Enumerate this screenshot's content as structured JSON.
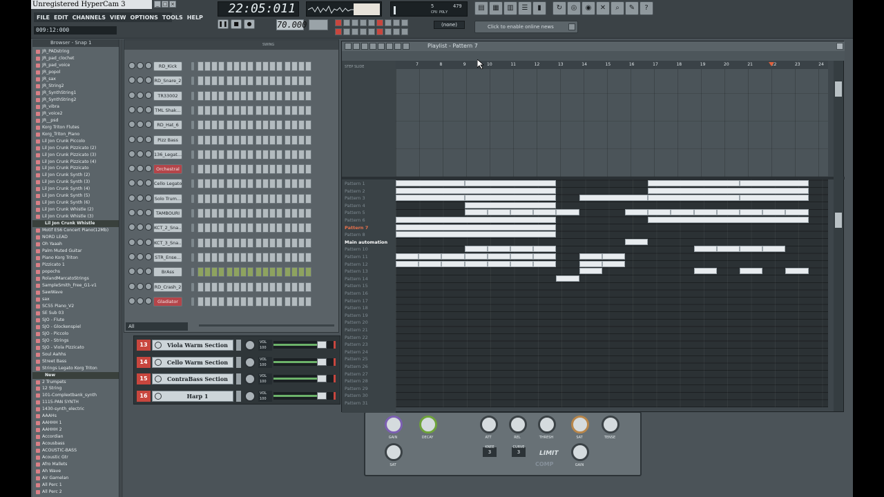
{
  "app": {
    "title": "Unregistered HyperCam 3",
    "menu": [
      "FILE",
      "EDIT",
      "CHANNELS",
      "VIEW",
      "OPTIONS",
      "TOOLS",
      "HELP"
    ],
    "song_time_small": "009:12:000",
    "clock": "22:05:011",
    "tempo": "70.000",
    "snap": "(none)",
    "news": "Click to enable online news",
    "cpu_a": "5",
    "cpu_b": "479",
    "cpu_c": "CPU POLY"
  },
  "browser": {
    "title": "Browser - Snap 1",
    "items": [
      {
        "label": "JR_PADstring",
        "type": "file"
      },
      {
        "label": "JR_pad_clochet",
        "type": "file"
      },
      {
        "label": "JR_pad_voice",
        "type": "file"
      },
      {
        "label": "JR_popol",
        "type": "file"
      },
      {
        "label": "JR_sax",
        "type": "file"
      },
      {
        "label": "JR_String2",
        "type": "file"
      },
      {
        "label": "JR_SynthString1",
        "type": "file"
      },
      {
        "label": "JR_SynthString2",
        "type": "file"
      },
      {
        "label": "JR_vibra",
        "type": "file"
      },
      {
        "label": "JR_voice2",
        "type": "file"
      },
      {
        "label": "JR__psd",
        "type": "file"
      },
      {
        "label": "Korg Triton Flutes",
        "type": "file"
      },
      {
        "label": "Korg_Triton_Piano",
        "type": "file"
      },
      {
        "label": "Lil Jon Crunk Piccolo",
        "type": "file"
      },
      {
        "label": "Lil Jon Crunk Pizzicato (2)",
        "type": "file"
      },
      {
        "label": "Lil Jon Crunk Pizzicato (3)",
        "type": "file"
      },
      {
        "label": "Lil Jon Crunk Pizzicato (4)",
        "type": "file"
      },
      {
        "label": "Lil Jon Crunk Pizzicato",
        "type": "file"
      },
      {
        "label": "Lil Jon Crunk Synth (2)",
        "type": "file"
      },
      {
        "label": "Lil Jon Crunk Synth (3)",
        "type": "file"
      },
      {
        "label": "Lil Jon Crunk Synth (4)",
        "type": "file"
      },
      {
        "label": "Lil Jon Crunk Synth (5)",
        "type": "file"
      },
      {
        "label": "Lil Jon Crunk Synth (6)",
        "type": "file"
      },
      {
        "label": "Lil Jon Crunk Whistle (2)",
        "type": "file"
      },
      {
        "label": "Lil Jon Crunk Whistle (3)",
        "type": "file"
      },
      {
        "label": "Lil Jon Crunk Whistle",
        "type": "folder"
      },
      {
        "label": "Motif ES6 Concert Piano(12Mb)",
        "type": "file"
      },
      {
        "label": "NORD LEAD",
        "type": "file"
      },
      {
        "label": "Oh Yaaah",
        "type": "file"
      },
      {
        "label": "Palm Muted Guitar",
        "type": "file"
      },
      {
        "label": "Piano Korg Triton",
        "type": "file"
      },
      {
        "label": "Pizzicato 1",
        "type": "file"
      },
      {
        "label": "popochs",
        "type": "file"
      },
      {
        "label": "RolandMarcatoStrings",
        "type": "file"
      },
      {
        "label": "SampleSmith_Free_G1-v1",
        "type": "file"
      },
      {
        "label": "SawWave",
        "type": "file"
      },
      {
        "label": "sax",
        "type": "file"
      },
      {
        "label": "SC55 Piano_V2",
        "type": "file"
      },
      {
        "label": "SE Sub 03",
        "type": "file"
      },
      {
        "label": "SJO - Flute",
        "type": "file"
      },
      {
        "label": "SJO - Glockenspiel",
        "type": "file"
      },
      {
        "label": "SJO - Piccolo",
        "type": "file"
      },
      {
        "label": "SJO - Strings",
        "type": "file"
      },
      {
        "label": "SJO - Viola Pizzicato",
        "type": "file"
      },
      {
        "label": "Soul Aahhs",
        "type": "file"
      },
      {
        "label": "Street Bass",
        "type": "file"
      },
      {
        "label": "Strings Legato Korg Triton",
        "type": "file"
      },
      {
        "label": "New",
        "type": "folder"
      },
      {
        "label": "2 Trumpets",
        "type": "file"
      },
      {
        "label": "12 String",
        "type": "file"
      },
      {
        "label": "101-Complextbank_synth",
        "type": "file"
      },
      {
        "label": "1115-PAN SYNTH",
        "type": "file"
      },
      {
        "label": "1430-synth_electric",
        "type": "file"
      },
      {
        "label": "AAAHs",
        "type": "file"
      },
      {
        "label": "AAHHH 1",
        "type": "file"
      },
      {
        "label": "AAHHH 2",
        "type": "file"
      },
      {
        "label": "Accordian",
        "type": "file"
      },
      {
        "label": "Acousbass",
        "type": "file"
      },
      {
        "label": "ACOUSTIC-BASS",
        "type": "file"
      },
      {
        "label": "Acoustic Gtr",
        "type": "file"
      },
      {
        "label": "Afro Mallets",
        "type": "file"
      },
      {
        "label": "Ah Wave",
        "type": "file"
      },
      {
        "label": "Air Gamelan",
        "type": "file"
      },
      {
        "label": "All Perc 1",
        "type": "file"
      },
      {
        "label": "All Perc 2",
        "type": "file"
      }
    ]
  },
  "channel_rack": {
    "swing_label": "SWING",
    "filter": "All",
    "channels": [
      {
        "name": "RD_Kick",
        "color": "grey"
      },
      {
        "name": "RD_Snare_2",
        "color": "grey"
      },
      {
        "name": "TR33002",
        "color": "grey"
      },
      {
        "name": "TML Shak...",
        "color": "grey"
      },
      {
        "name": "RD_Hat_6",
        "color": "grey"
      },
      {
        "name": "Pizz Bass",
        "color": "grey"
      },
      {
        "name": "136_Legat...",
        "color": "grey"
      },
      {
        "name": "Orchestral",
        "color": "red"
      },
      {
        "name": "Cello Legato",
        "color": "grey"
      },
      {
        "name": "Solo Trum...",
        "color": "grey"
      },
      {
        "name": "TAMBOURI",
        "color": "grey"
      },
      {
        "name": "KCT_2_Sna...",
        "color": "grey"
      },
      {
        "name": "KCT_3_Sna...",
        "color": "grey"
      },
      {
        "name": "STR_Ense...",
        "color": "grey"
      },
      {
        "name": "BrAss",
        "color": "grey"
      },
      {
        "name": "RD_Crash_2",
        "color": "grey"
      },
      {
        "name": "Gladiator",
        "color": "red"
      }
    ]
  },
  "mixer_strips": [
    {
      "num": "13",
      "name": "Viola Warm Section",
      "vol": "VOL",
      "pct": "100",
      "level": 0.78
    },
    {
      "num": "14",
      "name": "Cello Warm Section",
      "vol": "VOL",
      "pct": "100",
      "level": 0.78
    },
    {
      "num": "15",
      "name": "ContraBass Section",
      "vol": "VOL",
      "pct": "100",
      "level": 0.78
    },
    {
      "num": "16",
      "name": "Harp 1",
      "vol": "VOL",
      "pct": "100",
      "level": 0.78
    }
  ],
  "plugin": {
    "knobs": [
      "GAIN",
      "DECAY",
      "ATT",
      "REL",
      "THRESH",
      "SAT",
      "TENSE",
      "SAT",
      "GAIN"
    ],
    "boxes": [
      {
        "label": "KNEE",
        "value": "3"
      },
      {
        "label": "CURVE",
        "value": "3"
      }
    ],
    "limit": "LIMIT",
    "comp": "COMP"
  },
  "playlist": {
    "title": "Playlist - Pattern 7",
    "upper_labels": "STEP  SLIDE",
    "ruler": [
      "7",
      "8",
      "9",
      "10",
      "11",
      "12",
      "13",
      "14",
      "15",
      "16",
      "17",
      "18",
      "19",
      "20",
      "21",
      "22",
      "23",
      "24"
    ],
    "marker_bar": "22",
    "patterns": [
      {
        "label": "Pattern 1",
        "state": "dim"
      },
      {
        "label": "Pattern 2",
        "state": "dim"
      },
      {
        "label": "Pattern 3",
        "state": "dim"
      },
      {
        "label": "Pattern 4",
        "state": "dim"
      },
      {
        "label": "Pattern 5",
        "state": "dim"
      },
      {
        "label": "Pattern 6",
        "state": "dim"
      },
      {
        "label": "Pattern 7",
        "state": "active"
      },
      {
        "label": "Pattern 8",
        "state": "dim"
      },
      {
        "label": "Main automation",
        "state": "auto"
      },
      {
        "label": "Pattern 10",
        "state": "dim"
      },
      {
        "label": "Pattern 11",
        "state": "dim"
      },
      {
        "label": "Pattern 12",
        "state": "dim"
      },
      {
        "label": "Pattern 13",
        "state": "dim"
      },
      {
        "label": "Pattern 14",
        "state": "dim"
      },
      {
        "label": "Pattern 15",
        "state": "dim"
      },
      {
        "label": "Pattern 16",
        "state": "dim"
      },
      {
        "label": "Pattern 17",
        "state": "dim"
      },
      {
        "label": "Pattern 18",
        "state": "dim"
      },
      {
        "label": "Pattern 19",
        "state": "dim"
      },
      {
        "label": "Pattern 20",
        "state": "dim"
      },
      {
        "label": "Pattern 21",
        "state": "dim"
      },
      {
        "label": "Pattern 22",
        "state": "dim"
      },
      {
        "label": "Pattern 23",
        "state": "dim"
      },
      {
        "label": "Pattern 24",
        "state": "dim"
      },
      {
        "label": "Pattern 25",
        "state": "dim"
      },
      {
        "label": "Pattern 26",
        "state": "dim"
      },
      {
        "label": "Pattern 27",
        "state": "dim"
      },
      {
        "label": "Pattern 28",
        "state": "dim"
      },
      {
        "label": "Pattern 29",
        "state": "dim"
      },
      {
        "label": "Pattern 30",
        "state": "dim"
      },
      {
        "label": "Pattern 31",
        "state": "dim"
      }
    ],
    "clips": [
      {
        "row": 0,
        "start": 7,
        "end": 10
      },
      {
        "row": 0,
        "start": 10,
        "end": 14
      },
      {
        "row": 0,
        "start": 18,
        "end": 22
      },
      {
        "row": 0,
        "start": 22,
        "end": 25
      },
      {
        "row": 1,
        "start": 7,
        "end": 14
      },
      {
        "row": 1,
        "start": 18,
        "end": 25
      },
      {
        "row": 2,
        "start": 7,
        "end": 10
      },
      {
        "row": 2,
        "start": 10,
        "end": 14
      },
      {
        "row": 2,
        "start": 15,
        "end": 18
      },
      {
        "row": 2,
        "start": 18,
        "end": 22
      },
      {
        "row": 2,
        "start": 22,
        "end": 25
      },
      {
        "row": 3,
        "start": 10,
        "end": 14
      },
      {
        "row": 4,
        "start": 10,
        "end": 11
      },
      {
        "row": 4,
        "start": 11,
        "end": 12
      },
      {
        "row": 4,
        "start": 12,
        "end": 13
      },
      {
        "row": 4,
        "start": 13,
        "end": 14
      },
      {
        "row": 4,
        "start": 14,
        "end": 15
      },
      {
        "row": 4,
        "start": 17,
        "end": 18
      },
      {
        "row": 4,
        "start": 18,
        "end": 19
      },
      {
        "row": 4,
        "start": 19,
        "end": 20
      },
      {
        "row": 4,
        "start": 20,
        "end": 21
      },
      {
        "row": 4,
        "start": 21,
        "end": 22
      },
      {
        "row": 4,
        "start": 22,
        "end": 23
      },
      {
        "row": 4,
        "start": 23,
        "end": 24
      },
      {
        "row": 4,
        "start": 24,
        "end": 25
      },
      {
        "row": 5,
        "start": 7,
        "end": 14
      },
      {
        "row": 5,
        "start": 18,
        "end": 25
      },
      {
        "row": 6,
        "start": 7,
        "end": 14
      },
      {
        "row": 7,
        "start": 7,
        "end": 14
      },
      {
        "row": 8,
        "start": 17,
        "end": 18
      },
      {
        "row": 9,
        "start": 10,
        "end": 11
      },
      {
        "row": 9,
        "start": 11,
        "end": 12
      },
      {
        "row": 9,
        "start": 12,
        "end": 13
      },
      {
        "row": 9,
        "start": 13,
        "end": 14
      },
      {
        "row": 9,
        "start": 20,
        "end": 21
      },
      {
        "row": 9,
        "start": 21,
        "end": 22
      },
      {
        "row": 9,
        "start": 22,
        "end": 23
      },
      {
        "row": 9,
        "start": 23,
        "end": 24
      },
      {
        "row": 10,
        "start": 7,
        "end": 8
      },
      {
        "row": 10,
        "start": 8,
        "end": 9
      },
      {
        "row": 10,
        "start": 9,
        "end": 10
      },
      {
        "row": 10,
        "start": 10,
        "end": 11
      },
      {
        "row": 10,
        "start": 11,
        "end": 12
      },
      {
        "row": 10,
        "start": 12,
        "end": 13
      },
      {
        "row": 10,
        "start": 13,
        "end": 14
      },
      {
        "row": 10,
        "start": 15,
        "end": 16
      },
      {
        "row": 10,
        "start": 16,
        "end": 17
      },
      {
        "row": 11,
        "start": 7,
        "end": 8
      },
      {
        "row": 11,
        "start": 8,
        "end": 9
      },
      {
        "row": 11,
        "start": 9,
        "end": 10
      },
      {
        "row": 11,
        "start": 10,
        "end": 11
      },
      {
        "row": 11,
        "start": 11,
        "end": 12
      },
      {
        "row": 11,
        "start": 12,
        "end": 13
      },
      {
        "row": 11,
        "start": 13,
        "end": 14
      },
      {
        "row": 11,
        "start": 15,
        "end": 16
      },
      {
        "row": 11,
        "start": 16,
        "end": 17
      },
      {
        "row": 12,
        "start": 15,
        "end": 16
      },
      {
        "row": 12,
        "start": 20,
        "end": 21
      },
      {
        "row": 12,
        "start": 22,
        "end": 23
      },
      {
        "row": 12,
        "start": 24,
        "end": 25
      },
      {
        "row": 13,
        "start": 14,
        "end": 15
      }
    ]
  }
}
